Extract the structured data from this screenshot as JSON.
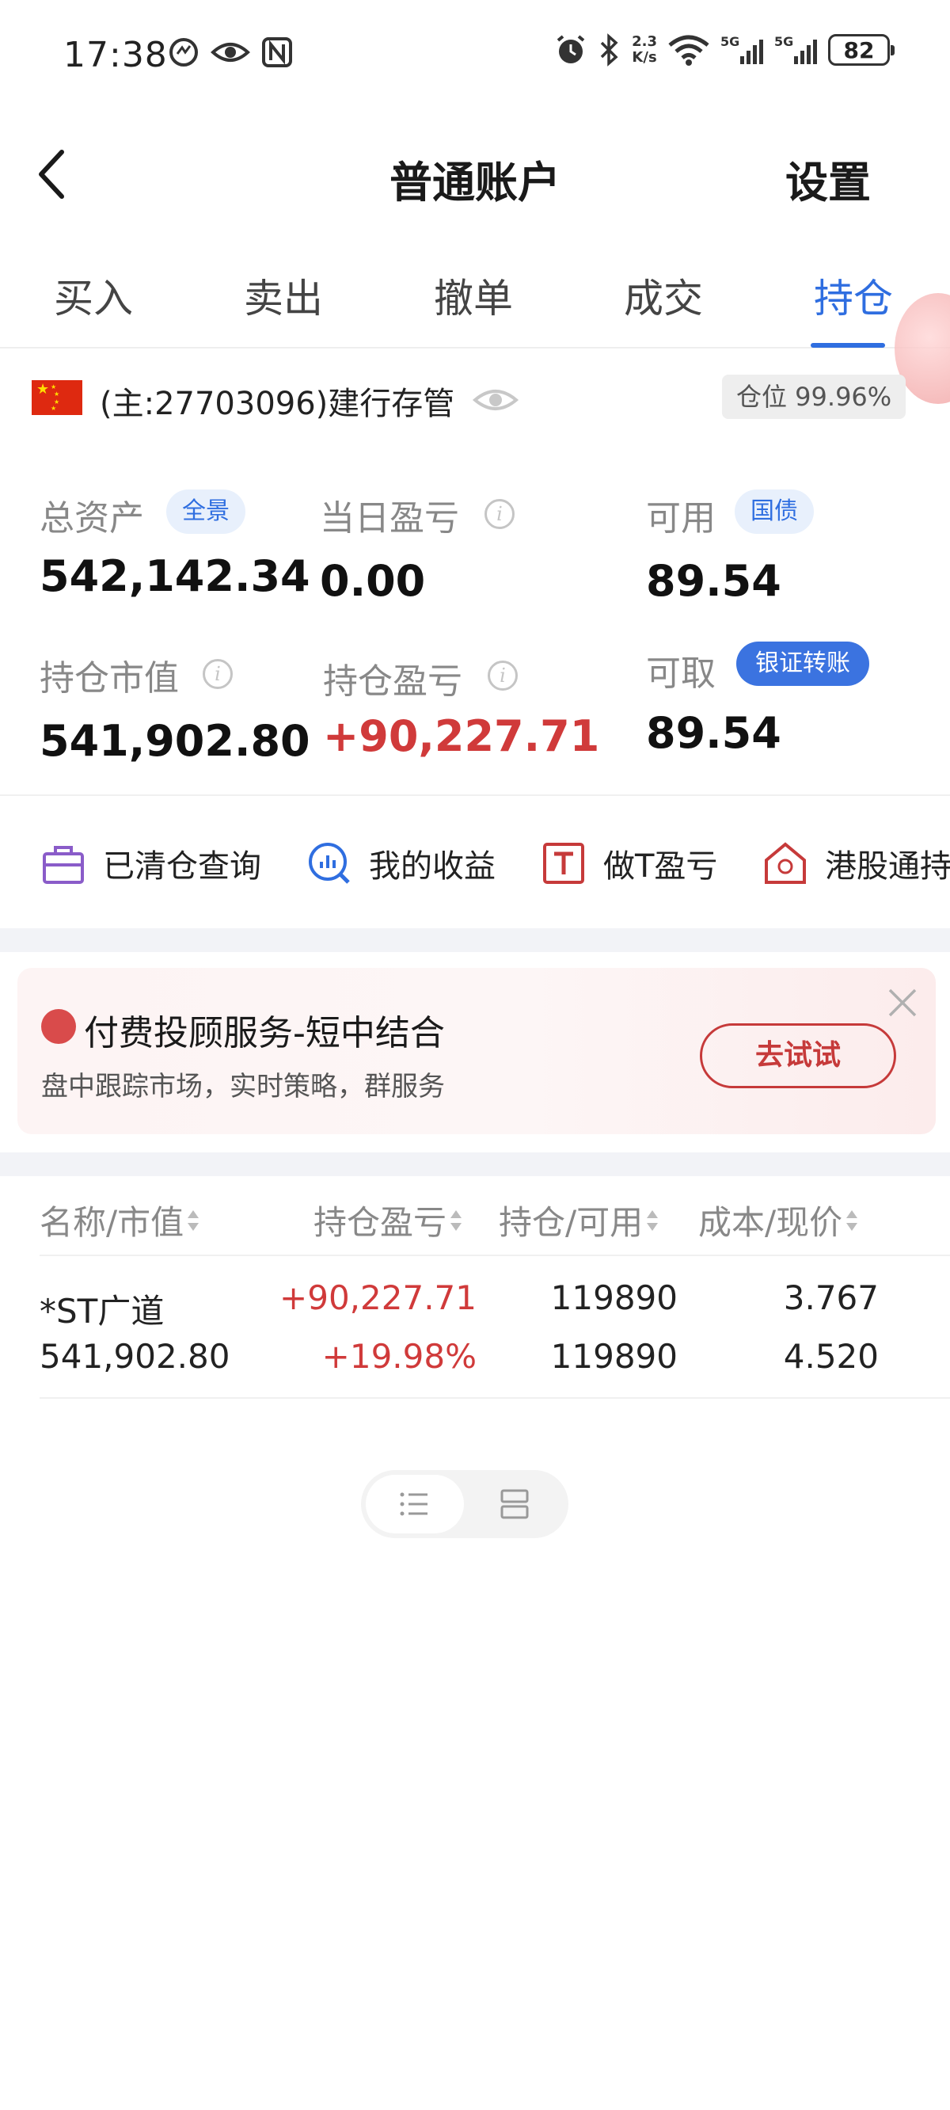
{
  "status_bar": {
    "time": "17:38",
    "net_speed_value": "2.3",
    "net_speed_unit": "K/s",
    "sim1_label": "5G",
    "sim2_label": "5G",
    "battery": "82"
  },
  "header": {
    "title": "普通账户",
    "settings_label": "设置"
  },
  "tabs": [
    {
      "label": "买入"
    },
    {
      "label": "卖出"
    },
    {
      "label": "撤单"
    },
    {
      "label": "成交"
    },
    {
      "label": "持仓",
      "active": true
    }
  ],
  "account": {
    "name": "(主:27703096)建行存管",
    "position_ratio": "仓位 99.96%"
  },
  "metrics": {
    "total_assets": {
      "label": "总资产",
      "tag": "全景",
      "value": "542,142.34"
    },
    "daily_pnl": {
      "label": "当日盈亏",
      "value": "0.00"
    },
    "available": {
      "label": "可用",
      "tag": "国债",
      "value": "89.54"
    },
    "market_value": {
      "label": "持仓市值",
      "value": "541,902.80"
    },
    "position_pnl": {
      "label": "持仓盈亏",
      "value": "+90,227.71"
    },
    "withdrawable": {
      "label": "可取",
      "tag": "银证转账",
      "value": "89.54"
    }
  },
  "quick_actions": [
    {
      "label": "已清仓查询",
      "icon": "briefcase-icon"
    },
    {
      "label": "我的收益",
      "icon": "chart-search-icon"
    },
    {
      "label": "做T盈亏",
      "icon": "t-box-icon"
    },
    {
      "label": "港股通持",
      "icon": "hk-house-icon"
    }
  ],
  "ad": {
    "title": "付费投顾服务-短中结合",
    "subtitle": "盘中跟踪市场，实时策略，群服务",
    "button": "去试试"
  },
  "table": {
    "headers": [
      "名称/市值",
      "持仓盈亏",
      "持仓/可用",
      "成本/现价"
    ],
    "rows": [
      {
        "name": "*ST广道",
        "market_value": "541,902.80",
        "pnl": "+90,227.71",
        "pnl_pct": "+19.98%",
        "position": "119890",
        "available": "119890",
        "cost": "3.767",
        "price": "4.520"
      }
    ]
  },
  "colors": {
    "accent_blue": "#2f6ee0",
    "profit_red": "#d03a3a",
    "muted_text": "#888888"
  }
}
